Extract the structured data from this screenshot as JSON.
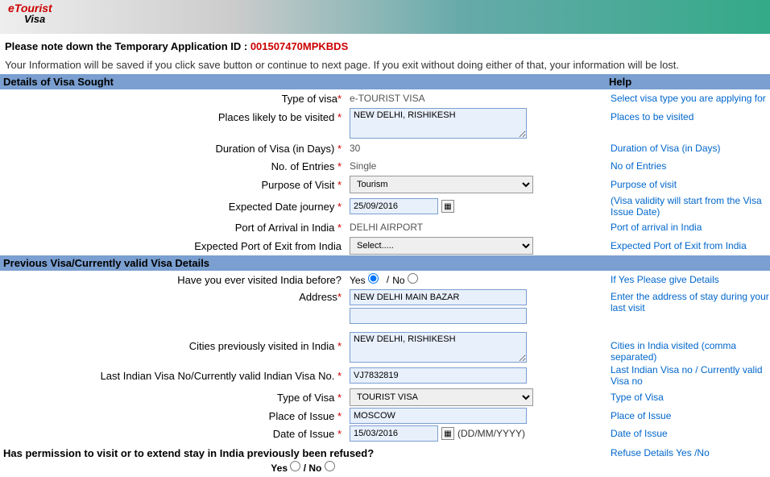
{
  "banner": {
    "logo_top": "eTourist",
    "logo_bottom": "Visa"
  },
  "notice": {
    "label": "Please note down the Temporary Application ID : ",
    "app_id": "001507470MPKBDS",
    "save_msg": "Your Information will be saved if you click save button or continue to next page. If you exit without doing either of that, your information will be lost."
  },
  "headers": {
    "details": "Details of Visa Sought",
    "help": "Help",
    "previous": "Previous Visa/Currently valid Visa Details"
  },
  "fields": {
    "type_of_visa": {
      "label": "Type of visa",
      "value": "e-TOURIST VISA",
      "help": "Select visa type you are applying for"
    },
    "places": {
      "label": "Places likely to be visited ",
      "value": "NEW DELHI, RISHIKESH",
      "help": "Places to be visited"
    },
    "duration": {
      "label": "Duration of Visa (in Days) ",
      "value": "30",
      "help": "Duration of Visa (in Days)"
    },
    "entries": {
      "label": "No. of Entries ",
      "value": "Single",
      "help": "No of Entries"
    },
    "purpose": {
      "label": "Purpose of Visit ",
      "value": "Tourism",
      "help": "Purpose of visit"
    },
    "expected_journey": {
      "label": "Expected Date journey ",
      "value": "25/09/2016",
      "help": "(Visa validity will start from the Visa Issue Date)"
    },
    "port_arrival": {
      "label": "Port of Arrival in India ",
      "value": "DELHI AIRPORT",
      "help": "Port of arrival in India"
    },
    "port_exit": {
      "label": "Expected Port of Exit from India",
      "value": "Select.....",
      "help": "Expected Port of Exit from India"
    },
    "visited_before": {
      "label": "Have you ever visited India before?",
      "yes": "Yes",
      "no": "No",
      "help": "If Yes Please give Details"
    },
    "address": {
      "label": "Address",
      "value1": "NEW DELHI MAIN BAZAR",
      "value2": "",
      "help": "Enter the address of stay during your last visit"
    },
    "cities_prev": {
      "label": "Cities previously visited in India ",
      "value": "NEW DELHI, RISHIKESH",
      "help": "Cities in India visited (comma separated)"
    },
    "last_visa_no": {
      "label": "Last Indian Visa No/Currently valid Indian Visa No. ",
      "value": "VJ7832819",
      "help": "Last Indian Visa no / Currently valid Visa no"
    },
    "type_of_visa2": {
      "label": "Type of Visa ",
      "value": "TOURIST VISA",
      "help": "Type of Visa"
    },
    "place_issue": {
      "label": "Place of Issue ",
      "value": "MOSCOW",
      "help": "Place of Issue"
    },
    "date_issue": {
      "label": "Date of Issue ",
      "value": "15/03/2016",
      "hint": "(DD/MM/YYYY)",
      "help": "Date of Issue"
    }
  },
  "refused": {
    "question": "Has permission to visit or to extend stay in India previously been refused?",
    "yes": "Yes",
    "no": "No",
    "slash": " / ",
    "help": "Refuse Details Yes /No"
  },
  "req": "*"
}
